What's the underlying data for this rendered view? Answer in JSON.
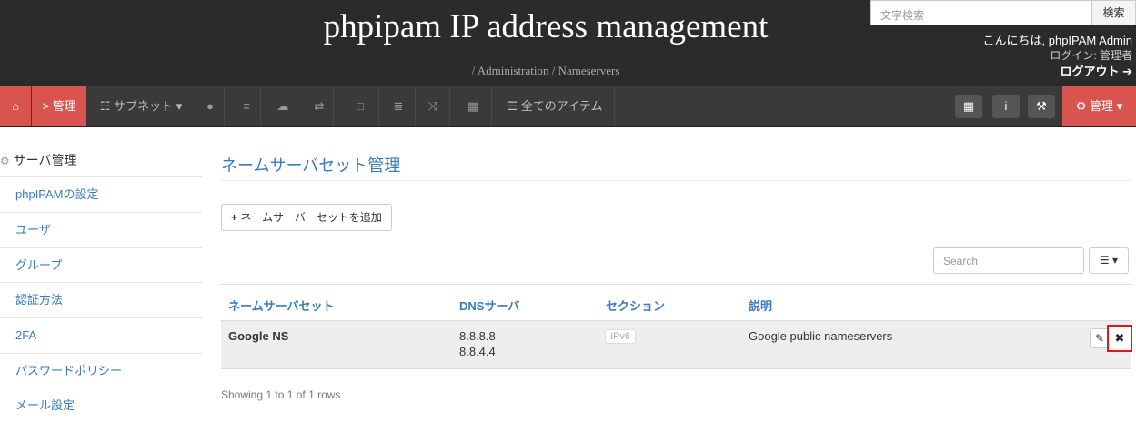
{
  "header": {
    "title": "phpipam IP address management",
    "breadcrumb": "/ Administration / Nameservers",
    "search_placeholder": "文字検索",
    "search_button": "検索",
    "greeting": "こんにちは, phpIPAM Admin",
    "login_as": "ログイン: 管理者",
    "logout": "ログアウト"
  },
  "navbar": {
    "home_icon": "home-icon",
    "admin_label": "> 管理",
    "subnets_label": "サブネット",
    "all_items_label": "全てのアイテム",
    "right_admin_label": "管理"
  },
  "sidebar": {
    "heading": "サーバ管理",
    "items": [
      "phpIPAMの設定",
      "ユーザ",
      "グループ",
      "認証方法",
      "2FA",
      "パスワードポリシー",
      "メール設定"
    ]
  },
  "main": {
    "title": "ネームサーバセット管理",
    "add_button": "ネームサーバーセットを追加",
    "search_placeholder": "Search",
    "columns": [
      "ネームサーバセット",
      "DNSサーバ",
      "セクション",
      "説明"
    ],
    "rows": [
      {
        "name": "Google NS",
        "dns1": "8.8.8.8",
        "dns2": "8.8.4.4",
        "section": "IPv6",
        "description": "Google public nameservers"
      }
    ],
    "footer": "Showing 1 to 1 of 1 rows"
  }
}
